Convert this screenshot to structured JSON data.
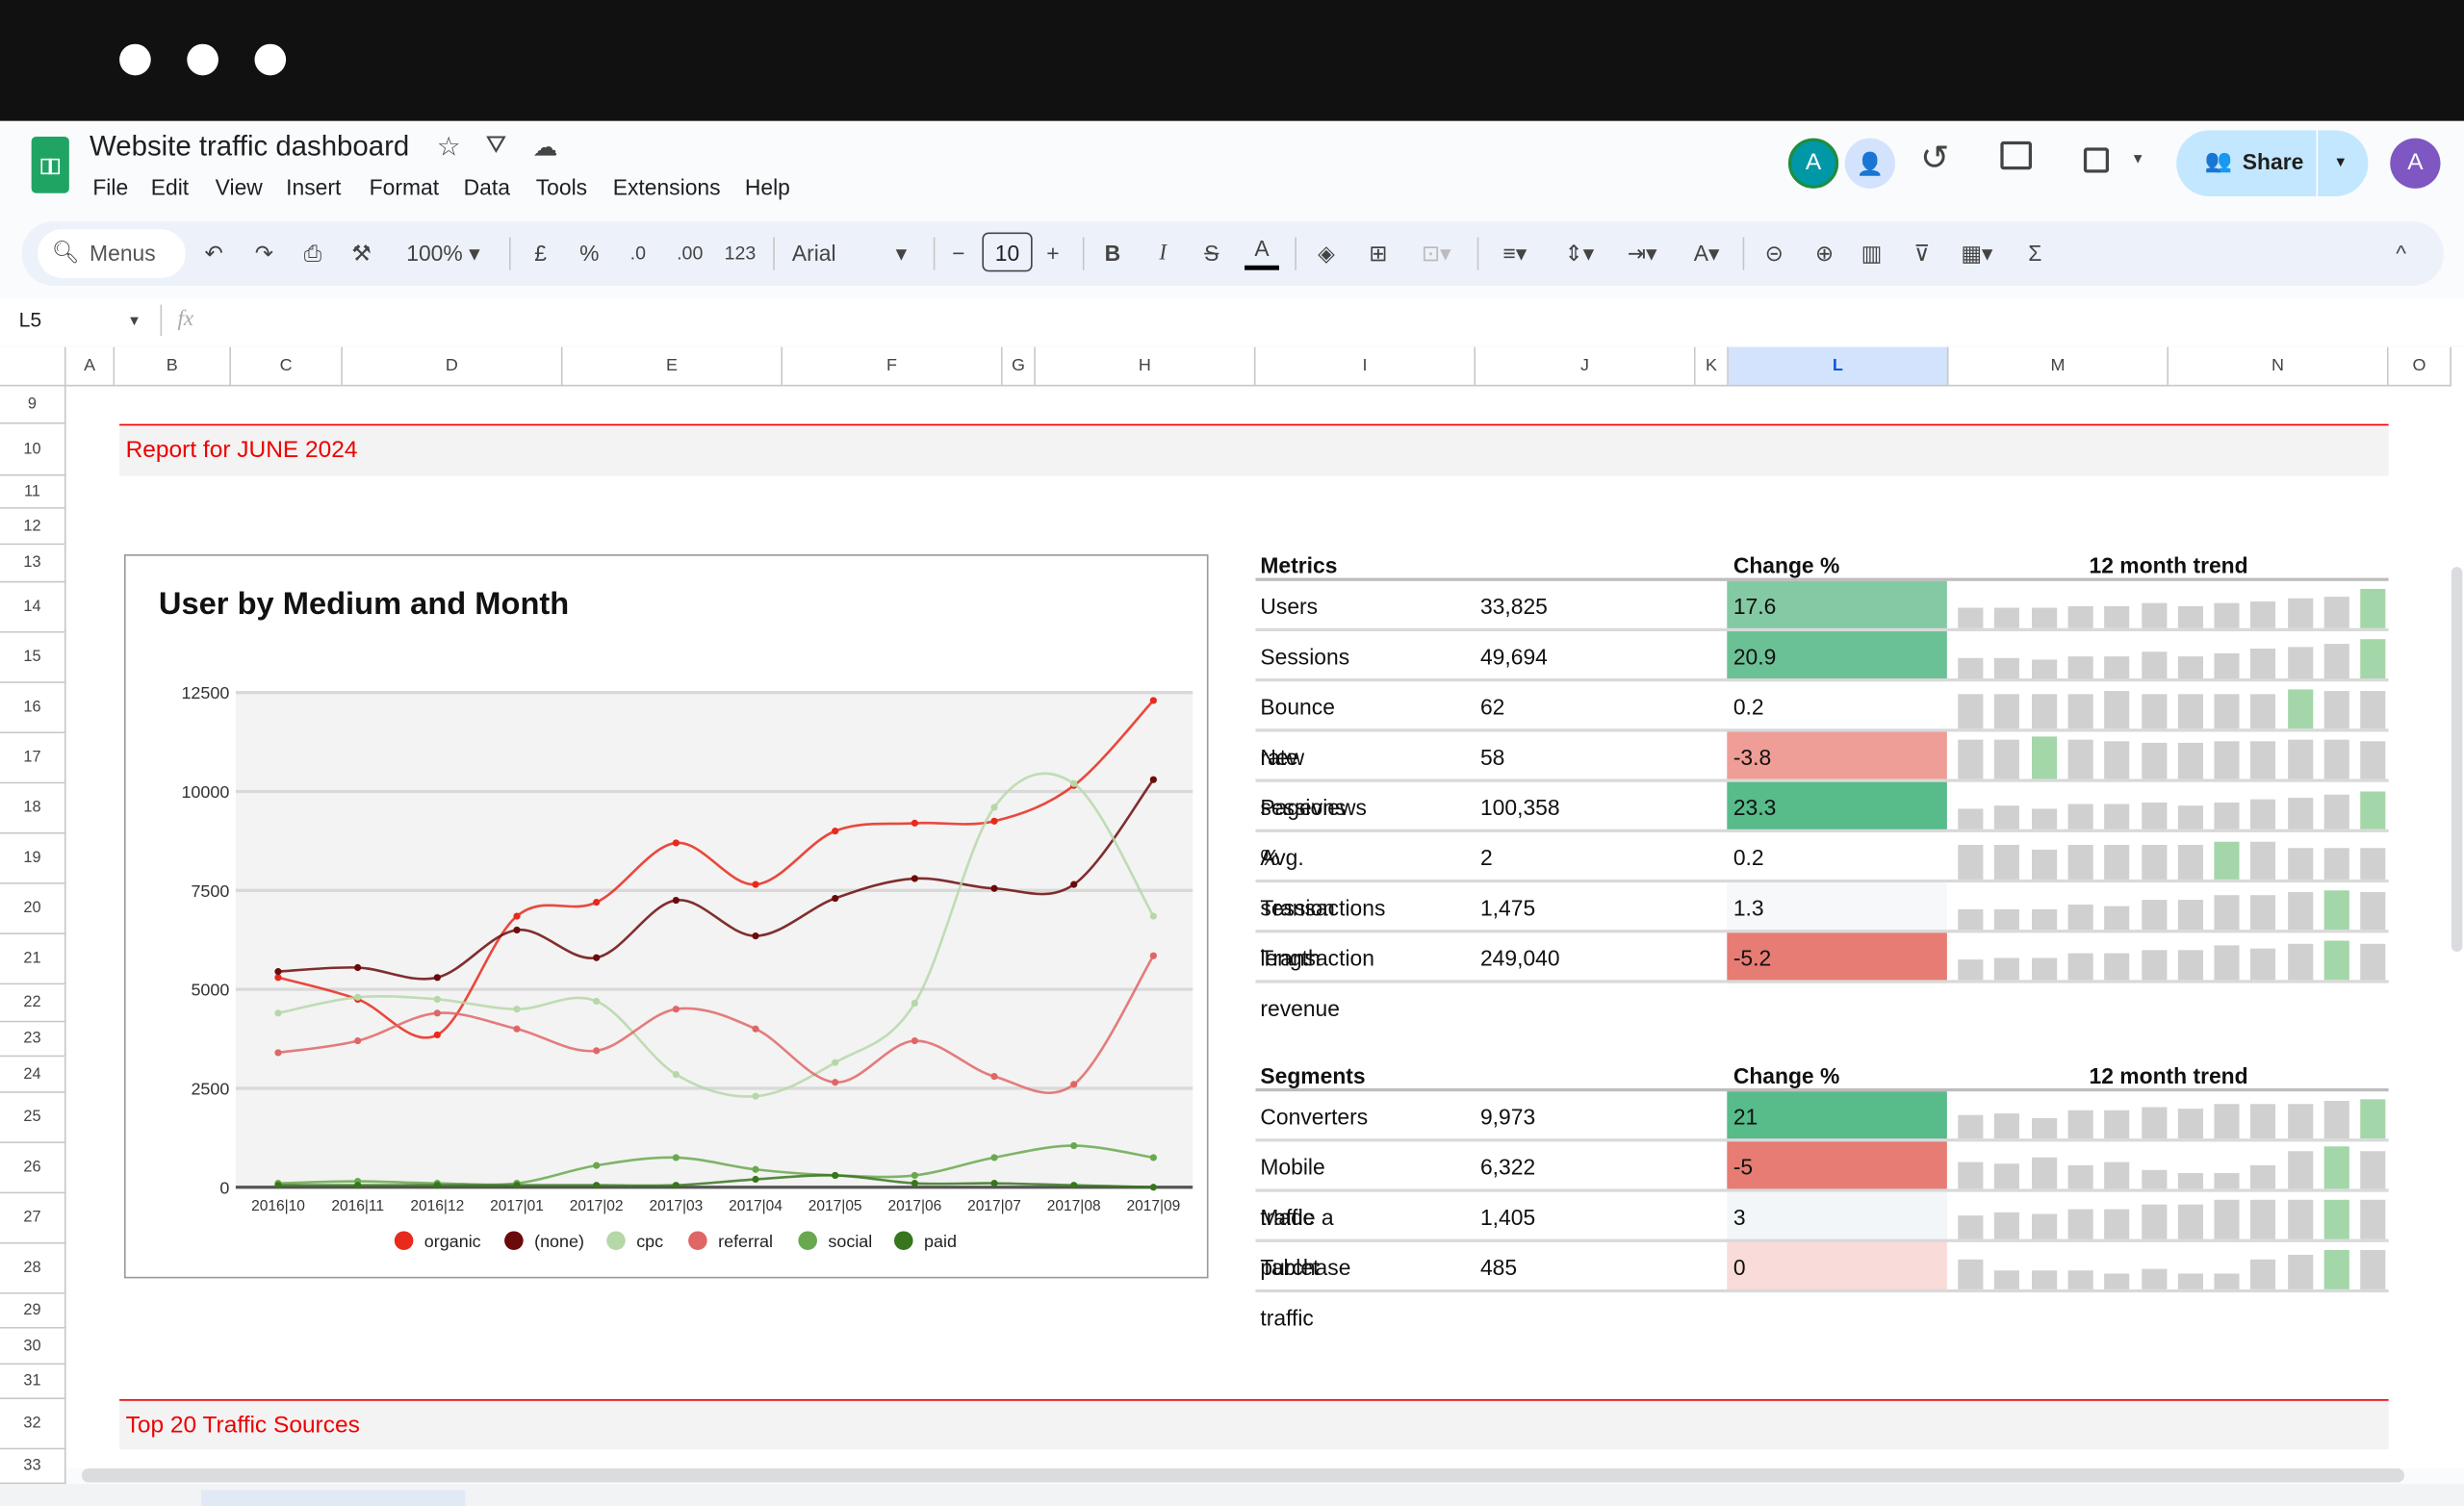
{
  "app": {
    "title": "Website traffic dashboard",
    "menus": [
      "File",
      "Edit",
      "View",
      "Insert",
      "Format",
      "Data",
      "Tools",
      "Extensions",
      "Help"
    ],
    "share_label": "Share",
    "avatar_letter": "A",
    "collab_letter": "A"
  },
  "toolbar": {
    "search_label": "Menus",
    "zoom": "100%",
    "currency": "£",
    "percent": "%",
    "dec_decrease": ".0",
    "dec_increase": ".00",
    "format_123": "123",
    "font": "Arial",
    "font_size": "10",
    "bold": "B",
    "italic": "I",
    "text_color_label": "A",
    "sum": "Σ"
  },
  "formula_bar": {
    "cell_ref": "L5",
    "fx": "fx",
    "value": ""
  },
  "columns": [
    "A",
    "B",
    "C",
    "D",
    "E",
    "F",
    "G",
    "H",
    "I",
    "J",
    "K",
    "L",
    "M",
    "N",
    "O"
  ],
  "selected_column": "L",
  "rows": [
    "9",
    "10",
    "11",
    "12",
    "13",
    "14",
    "15",
    "16",
    "17",
    "18",
    "19",
    "20",
    "21",
    "22",
    "23",
    "24",
    "25",
    "26",
    "27",
    "28",
    "29",
    "30",
    "31",
    "32",
    "33"
  ],
  "report_title": "Report for JUNE 2024",
  "section2_title": "Top 20 Traffic Sources",
  "metrics": {
    "header": {
      "label": "Metrics",
      "change": "Change %",
      "trend": "12 month trend"
    },
    "rows": [
      {
        "label": "Users",
        "value": "33,825",
        "change": "17.6",
        "color": "#83c9a4",
        "trend": [
          45,
          45,
          45,
          48,
          48,
          53,
          48,
          53,
          58,
          65,
          68,
          85
        ],
        "hl": 11
      },
      {
        "label": "Sessions",
        "value": "49,694",
        "change": "20.9",
        "color": "#6bc196",
        "trend": [
          45,
          45,
          40,
          48,
          48,
          58,
          48,
          53,
          63,
          68,
          72,
          85
        ],
        "hl": 11
      },
      {
        "label": "Bounce rate",
        "value": "62",
        "change": "0.2",
        "color": "#ffffff",
        "trend": [
          75,
          75,
          75,
          75,
          80,
          75,
          75,
          75,
          75,
          85,
          80,
          80
        ],
        "hl": 9
      },
      {
        "label": "New sessions %",
        "value": "58",
        "change": "-3.8",
        "color": "#ee9e96",
        "trend": [
          85,
          85,
          90,
          85,
          80,
          78,
          78,
          80,
          80,
          85,
          85,
          80
        ],
        "hl": 2
      },
      {
        "label": "Pageviews",
        "value": "100,358",
        "change": "23.3",
        "color": "#57bb8a",
        "trend": [
          45,
          50,
          45,
          53,
          53,
          58,
          50,
          58,
          63,
          68,
          73,
          80
        ],
        "hl": 11
      },
      {
        "label": "Avg. session length",
        "value": "2",
        "change": "0.2",
        "color": "#ffffff",
        "trend": [
          72,
          75,
          62,
          75,
          72,
          75,
          75,
          80,
          80,
          68,
          68,
          68
        ],
        "hl": 7
      },
      {
        "label": "Transactions",
        "value": "1,475",
        "change": "1.3",
        "color": "#f6f8f9",
        "trend": [
          45,
          45,
          45,
          55,
          50,
          63,
          63,
          72,
          72,
          80,
          85,
          80
        ],
        "hl": 10
      },
      {
        "label": "Transaction revenue",
        "value": "249,040",
        "change": "-5.2",
        "color": "#e67c73",
        "trend": [
          45,
          48,
          48,
          58,
          58,
          63,
          63,
          72,
          68,
          78,
          85,
          78
        ],
        "hl": 10
      }
    ]
  },
  "segments": {
    "header": {
      "label": "Segments",
      "change": "Change %",
      "trend": "12 month trend"
    },
    "rows": [
      {
        "label": "Converters",
        "value": "9,973",
        "change": "21",
        "color": "#57bb8a",
        "trend": [
          50,
          55,
          45,
          60,
          60,
          68,
          63,
          72,
          72,
          75,
          80,
          85
        ],
        "hl": 11
      },
      {
        "label": "Mobile traffic",
        "value": "6,322",
        "change": "-5",
        "color": "#e67c73",
        "trend": [
          58,
          55,
          68,
          50,
          58,
          40,
          32,
          32,
          50,
          80,
          90,
          80
        ],
        "hl": 10
      },
      {
        "label": "Made a purchase",
        "value": "1,405",
        "change": "3",
        "color": "#f3f6f8",
        "trend": [
          50,
          58,
          55,
          63,
          63,
          72,
          72,
          82,
          82,
          85,
          85,
          85
        ],
        "hl": 10
      },
      {
        "label": "Tablet traffic",
        "value": "485",
        "change": "0",
        "color": "#f9dbd9",
        "trend": [
          65,
          40,
          40,
          40,
          32,
          42,
          35,
          35,
          65,
          72,
          85,
          85
        ],
        "hl": 10
      }
    ]
  },
  "chart_data": {
    "type": "line",
    "title": "User by Medium and Month",
    "categories": [
      "2016|10",
      "2016|11",
      "2016|12",
      "2017|01",
      "2017|02",
      "2017|03",
      "2017|04",
      "2017|05",
      "2017|06",
      "2017|07",
      "2017|08",
      "2017|09"
    ],
    "ylim": [
      0,
      12500
    ],
    "yticks": [
      "0",
      "2500",
      "5000",
      "7500",
      "10000",
      "12500"
    ],
    "grid": true,
    "legend": "bottom",
    "series": [
      {
        "name": "organic",
        "color": "#e8291c",
        "values": [
          5300,
          4750,
          3850,
          6850,
          7200,
          8700,
          7650,
          9000,
          9200,
          9250,
          10150,
          12300
        ]
      },
      {
        "name": "(none)",
        "color": "#6b0a0a",
        "values": [
          5450,
          5550,
          5300,
          6500,
          5800,
          7250,
          6350,
          7300,
          7800,
          7550,
          7650,
          10300
        ]
      },
      {
        "name": "cpc",
        "color": "#b6d7a8",
        "values": [
          4400,
          4800,
          4750,
          4500,
          4700,
          2850,
          2300,
          3150,
          4650,
          9600,
          10200,
          6850
        ]
      },
      {
        "name": "referral",
        "color": "#e06666",
        "values": [
          3400,
          3700,
          4400,
          4000,
          3450,
          4500,
          4000,
          2650,
          3700,
          2800,
          2600,
          5850
        ]
      },
      {
        "name": "social",
        "color": "#6aa84f",
        "values": [
          100,
          150,
          100,
          100,
          550,
          750,
          450,
          300,
          300,
          750,
          1050,
          750
        ]
      },
      {
        "name": "paid",
        "color": "#38761d",
        "values": [
          50,
          50,
          50,
          50,
          50,
          50,
          200,
          300,
          100,
          100,
          50,
          0
        ]
      }
    ]
  }
}
